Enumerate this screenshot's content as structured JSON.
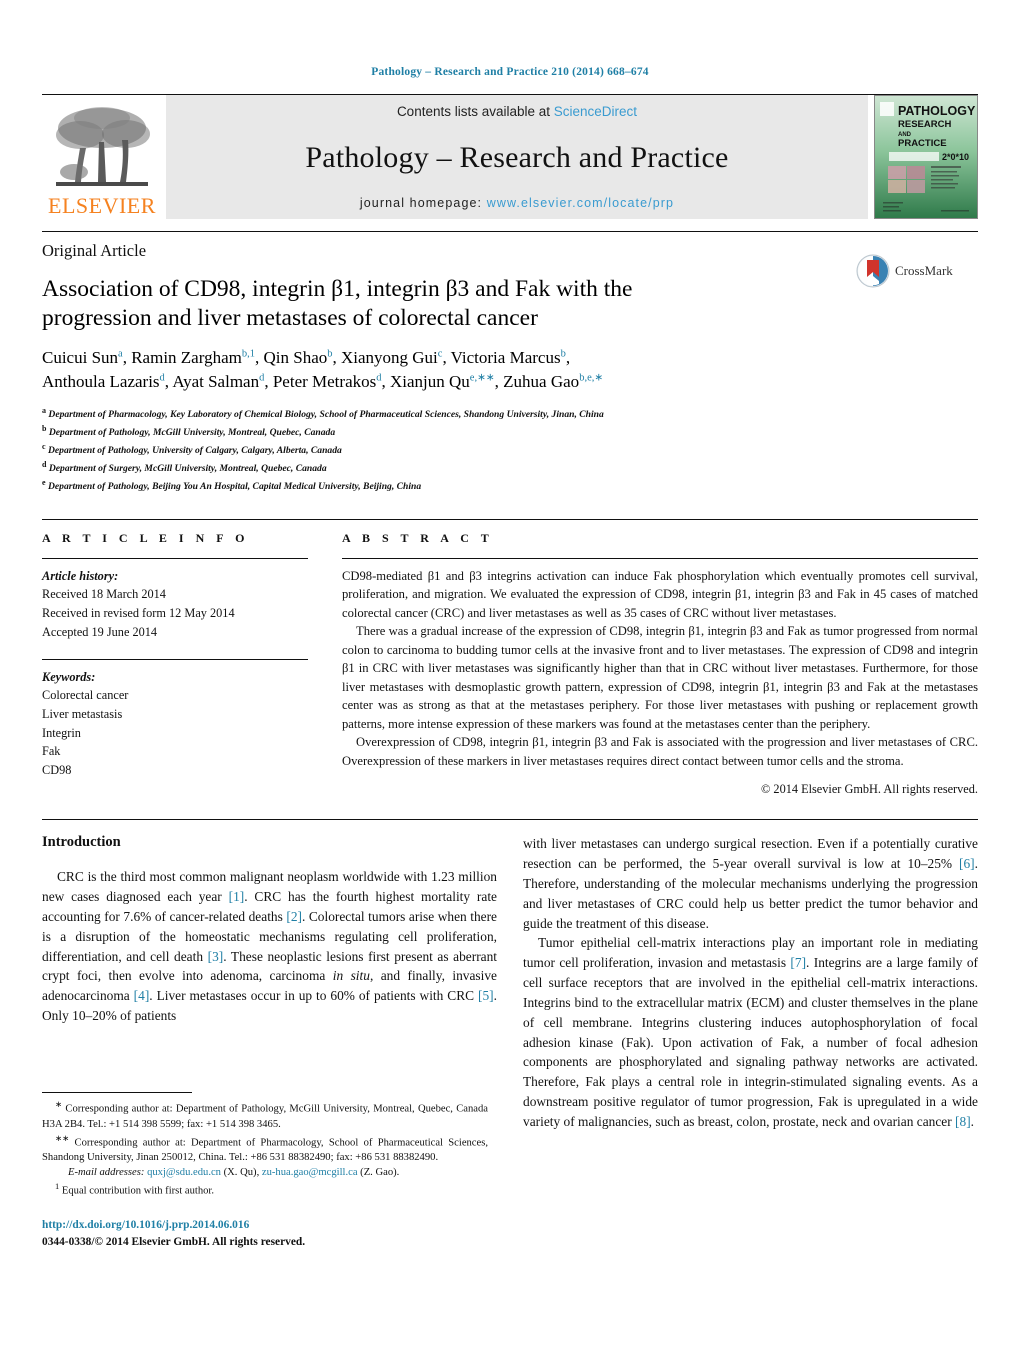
{
  "running_head": "Pathology – Research and Practice 210 (2014) 668–674",
  "masthead": {
    "publisher_name": "ELSEVIER",
    "contents_prefix": "Contents lists available at ",
    "contents_link": "ScienceDirect",
    "journal_title": "Pathology – Research and Practice",
    "homepage_prefix": "journal homepage: ",
    "homepage_url": "www.elsevier.com/locate/prp",
    "cover": {
      "line1": "PATHOLOGY",
      "line2": "RESEARCH",
      "line3": "AND",
      "line4": "PRACTICE",
      "issue": "2*0*10"
    }
  },
  "article": {
    "type": "Original Article",
    "title": "Association of CD98, integrin β1, integrin β3 and Fak with the progression and liver metastases of colorectal cancer",
    "crossmark_label": "CrossMark",
    "authors_line1": "Cuicui Sun<sup>a</sup>, Ramin Zargham<sup>b,1</sup>, Qin Shao<sup>b</sup>, Xianyong Gui<sup>c</sup>, Victoria Marcus<sup>b</sup>,",
    "authors_line2": "Anthoula Lazaris<sup>d</sup>, Ayat Salman<sup>d</sup>, Peter Metrakos<sup>d</sup>, Xianjun Qu<sup>e,∗∗</sup>, Zuhua Gao<sup>b,e,∗</sup>",
    "affiliations": [
      "<sup>a</sup> Department of Pharmacology, Key Laboratory of Chemical Biology, School of Pharmaceutical Sciences, Shandong University, Jinan, China",
      "<sup>b</sup> Department of Pathology, McGill University, Montreal, Quebec, Canada",
      "<sup>c</sup> Department of Pathology, University of Calgary, Calgary, Alberta, Canada",
      "<sup>d</sup> Department of Surgery, McGill University, Montreal, Quebec, Canada",
      "<sup>e</sup> Department of Pathology, Beijing You An Hospital, Capital Medical University, Beijing, China"
    ]
  },
  "article_info": {
    "heading": "A R T I C L E   I N F O",
    "history_label": "Article history:",
    "history": [
      "Received 18 March 2014",
      "Received in revised form 12 May 2014",
      "Accepted 19 June 2014"
    ],
    "keywords_label": "Keywords:",
    "keywords": [
      "Colorectal cancer",
      "Liver metastasis",
      "Integrin",
      "Fak",
      "CD98"
    ]
  },
  "abstract": {
    "heading": "A B S T R A C T",
    "paragraphs": [
      "CD98-mediated β1 and β3 integrins activation can induce Fak phosphorylation which eventually promotes cell survival, proliferation, and migration. We evaluated the expression of CD98, integrin β1, integrin β3 and Fak in 45 cases of matched colorectal cancer (CRC) and liver metastases as well as 35 cases of CRC without liver metastases.",
      "There was a gradual increase of the expression of CD98, integrin β1, integrin β3 and Fak as tumor progressed from normal colon to carcinoma to budding tumor cells at the invasive front and to liver metastases. The expression of CD98 and integrin β1 in CRC with liver metastases was significantly higher than that in CRC without liver metastases. Furthermore, for those liver metastases with desmoplastic growth pattern, expression of CD98, integrin β1, integrin β3 and Fak at the metastases center was as strong as that at the metastases periphery. For those liver metastases with pushing or replacement growth patterns, more intense expression of these markers was found at the metastases center than the periphery.",
      "Overexpression of CD98, integrin β1, integrin β3 and Fak is associated with the progression and liver metastases of CRC. Overexpression of these markers in liver metastases requires direct contact between tumor cells and the stroma."
    ],
    "copyright": "© 2014 Elsevier GmbH. All rights reserved."
  },
  "body": {
    "section_heading": "Introduction",
    "left_paragraph": "CRC is the third most common malignant neoplasm worldwide with 1.23 million new cases diagnosed each year <span class=\"ref\">[1]</span>. CRC has the fourth highest mortality rate accounting for 7.6% of cancer-related deaths <span class=\"ref\">[2]</span>. Colorectal tumors arise when there is a disruption of the homeostatic mechanisms regulating cell proliferation, differentiation, and cell death <span class=\"ref\">[3]</span>. These neoplastic lesions first present as aberrant crypt foci, then evolve into adenoma, carcinoma <i>in situ</i>, and finally, invasive adenocarcinoma <span class=\"ref\">[4]</span>. Liver metastases occur in up to 60% of patients with CRC <span class=\"ref\">[5]</span>. Only 10–20% of patients",
    "right_paragraph_1": "with liver metastases can undergo surgical resection. Even if a potentially curative resection can be performed, the 5-year overall survival is low at 10–25% <span class=\"ref\">[6]</span>. Therefore, understanding of the molecular mechanisms underlying the progression and liver metastases of CRC could help us better predict the tumor behavior and guide the treatment of this disease.",
    "right_paragraph_2": "Tumor epithelial cell-matrix interactions play an important role in mediating tumor cell proliferation, invasion and metastasis <span class=\"ref\">[7]</span>. Integrins are a large family of cell surface receptors that are involved in the epithelial cell-matrix interactions. Integrins bind to the extracellular matrix (ECM) and cluster themselves in the plane of cell membrane. Integrins clustering induces autophosphorylation of focal adhesion kinase (Fak). Upon activation of Fak, a number of focal adhesion components are phosphorylated and signaling pathway networks are activated. Therefore, Fak plays a central role in integrin-stimulated signaling events. As a downstream positive regulator of tumor progression, Fak is upregulated in a wide variety of malignancies, such as breast, colon, prostate, neck and ovarian cancer <span class=\"ref\">[8]</span>."
  },
  "footnotes": {
    "corr1": "<sup>∗</sup> Corresponding author at: Department of Pathology, McGill University, Montreal, Quebec, Canada H3A 2B4. Tel.: +1 514 398 5599; fax: +1 514 398 3465.",
    "corr2": "<sup>∗∗</sup> Corresponding author at: Department of Pharmacology, School of Pharmaceutical Sciences, Shandong University, Jinan 250012, China. Tel.: +86 531 88382490; fax: +86 531 88382490.",
    "emails": "<span class=\"it\">E-mail addresses:</span> <span class=\"lnk\">quxj@sdu.edu.cn</span> (X. Qu), <span class=\"lnk\">zu-hua.gao@mcgill.ca</span> (Z. Gao).",
    "equal": "<sup>1</sup> Equal contribution with first author.",
    "doi": "http://dx.doi.org/10.1016/j.prp.2014.06.016",
    "issn": "0344-0338/© 2014 Elsevier GmbH. All rights reserved."
  },
  "colors": {
    "link_blue": "#1f7fa5",
    "sd_blue": "#3a9bd0",
    "elsevier_orange": "#F58220",
    "band_gray": "#e8e8e8"
  }
}
